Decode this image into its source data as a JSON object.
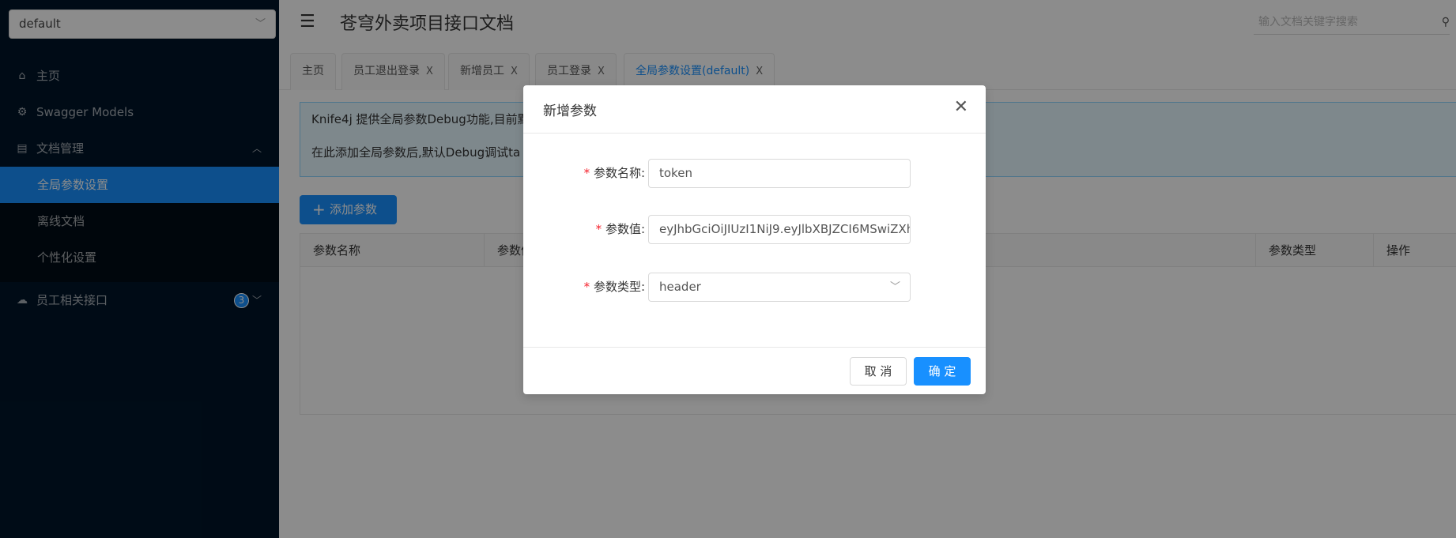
{
  "sidebar": {
    "group_select": "default",
    "items": [
      {
        "label": "主页",
        "icon": "home-icon"
      },
      {
        "label": "Swagger Models",
        "icon": "settings-icon"
      },
      {
        "label": "文档管理",
        "icon": "document-settings-icon"
      },
      {
        "label": "全局参数设置"
      },
      {
        "label": "离线文档"
      },
      {
        "label": "个性化设置"
      },
      {
        "label": "员工相关接口",
        "icon": "cloud-icon",
        "badge": "3"
      }
    ]
  },
  "header": {
    "title": "苍穹外卖项目接口文档",
    "search_placeholder": "输入文档关键字搜索"
  },
  "tabs": [
    {
      "label": "主页"
    },
    {
      "label": "员工退出登录"
    },
    {
      "label": "新增员工"
    },
    {
      "label": "员工登录"
    },
    {
      "label": "全局参数设置(default)"
    }
  ],
  "tab_close": "X",
  "content": {
    "alert_line1": "Knife4j 提供全局参数Debug功能,目前默",
    "alert_line2": "在此添加全局参数后,默认Debug调试ta",
    "add_button": "添加参数",
    "columns": [
      "参数名称",
      "参数值",
      "参数类型",
      "操作"
    ]
  },
  "modal": {
    "title": "新增参数",
    "fields": [
      {
        "label": "参数名称:",
        "value": "token"
      },
      {
        "label": "参数值:",
        "value": "eyJhbGciOiJIUzI1NiJ9.eyJlbXBJZCI6MSwiZXh"
      },
      {
        "label": "参数类型:",
        "value": "header"
      }
    ],
    "required_mark": "*",
    "cancel": "取 消",
    "ok": "确 定"
  },
  "colors": {
    "primary": "#1890ff",
    "sidebar_bg": "#001529",
    "required": "#f5222d"
  }
}
